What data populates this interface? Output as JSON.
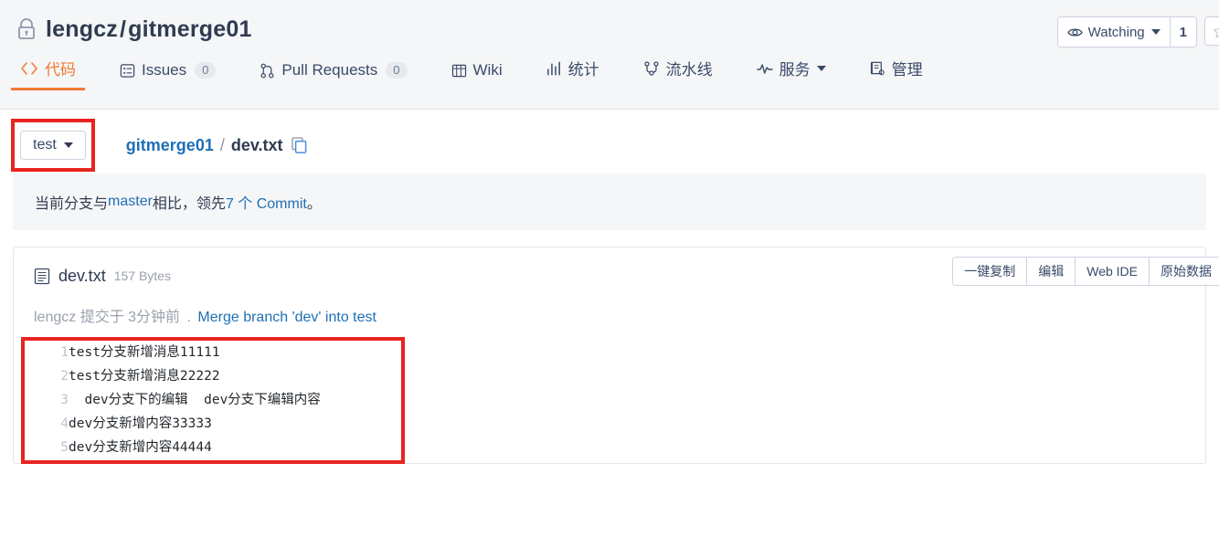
{
  "header": {
    "lock_icon": "lock-icon",
    "owner": "lengcz",
    "separator": "/",
    "repo": "gitmerge01",
    "watch": {
      "icon": "eye-icon",
      "label": "Watching",
      "count": "1",
      "star_icon": "star-icon"
    }
  },
  "nav": {
    "tabs": [
      {
        "label": "代码",
        "icon": "code-icon",
        "active": true,
        "badge": null
      },
      {
        "label": "Issues",
        "icon": "issues-icon",
        "active": false,
        "badge": "0"
      },
      {
        "label": "Pull Requests",
        "icon": "pull-request-icon",
        "active": false,
        "badge": "0"
      },
      {
        "label": "Wiki",
        "icon": "wiki-icon",
        "active": false,
        "badge": null
      },
      {
        "label": "统计",
        "icon": "stats-icon",
        "active": false,
        "badge": null
      },
      {
        "label": "流水线",
        "icon": "pipeline-icon",
        "active": false,
        "badge": null
      },
      {
        "label": "服务",
        "icon": "service-icon",
        "active": false,
        "badge": null,
        "dropdown": true
      },
      {
        "label": "管理",
        "icon": "manage-icon",
        "active": false,
        "badge": null
      }
    ]
  },
  "branch_bar": {
    "branch_label": "test",
    "breadcrumb": {
      "repo": "gitmerge01",
      "separator": "/",
      "file": "dev.txt",
      "copy_icon": "copy-icon"
    }
  },
  "banner": {
    "prefix": "当前分支与 ",
    "base_branch": "master",
    "middle": " 相比，领先 ",
    "commit_link": "7 个 Commit",
    "suffix": "。"
  },
  "file": {
    "icon": "file-text-icon",
    "name": "dev.txt",
    "size": "157 Bytes",
    "actions": [
      {
        "label": "一键复制"
      },
      {
        "label": "编辑"
      },
      {
        "label": "Web IDE"
      },
      {
        "label": "原始数据"
      }
    ],
    "commit": {
      "author": "lengcz",
      "time_text": " 提交于 3分钟前 ",
      "dot": ".",
      "message": "Merge branch 'dev' into test"
    },
    "lines": [
      {
        "n": "1",
        "text": "test分支新增消息11111"
      },
      {
        "n": "2",
        "text": "test分支新增消息22222"
      },
      {
        "n": "3",
        "text": "  dev分支下的编辑  dev分支下编辑内容"
      },
      {
        "n": "4",
        "text": "dev分支新增内容33333"
      },
      {
        "n": "5",
        "text": "dev分支新增内容44444"
      }
    ]
  },
  "annotations": {
    "branch_box_color": "#e8241f",
    "code_box_color": "#e8241f"
  },
  "colors": {
    "accent": "#f27935",
    "link": "#1f6fb5",
    "text": "#303b50",
    "muted": "#9aa1ae",
    "strip_bg": "#f5f6f7"
  }
}
